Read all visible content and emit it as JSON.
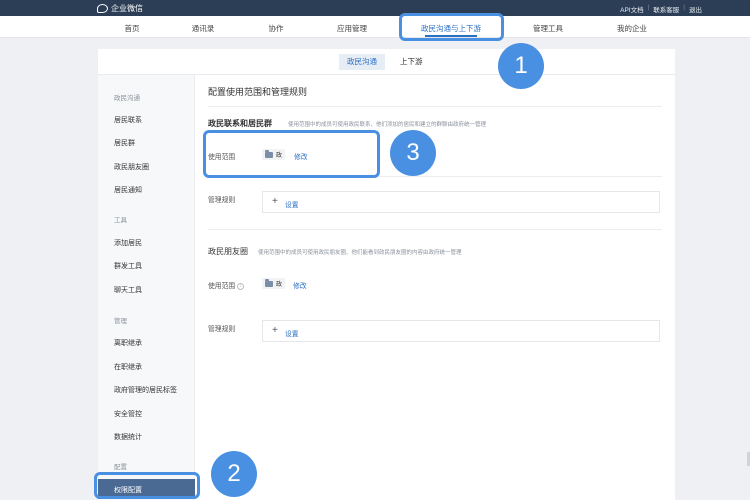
{
  "topbar": {
    "logo_text": "企业微信",
    "links": [
      "API文档",
      "联系客服",
      "退出"
    ]
  },
  "nav": {
    "items": [
      "首页",
      "通讯录",
      "协作",
      "应用管理",
      "政民沟通与上下游",
      "管理工具",
      "我的企业"
    ],
    "active_index": 4
  },
  "subtabs": {
    "active": "政民沟通",
    "other": "上下游"
  },
  "sidebar": {
    "group1": "政民沟通",
    "g1_items": [
      "居民联系",
      "居民群",
      "政民朋友圈",
      "居民通知"
    ],
    "group2": "工具",
    "g2_items": [
      "添加居民",
      "群发工具",
      "聊天工具"
    ],
    "group3": "管理",
    "g3_items": [
      "离职继承",
      "在职继承",
      "政府管理的居民标签",
      "安全管控",
      "数据统计"
    ],
    "group4": "配置",
    "active_item": "权限配置"
  },
  "content": {
    "page_title": "配置使用范围和管理规则",
    "section1": {
      "title": "政民联系和居民群",
      "desc": "使用范围中的成员可使用政民联系、他们添加的居民和建立的群聊由政府统一管理",
      "scope_label": "使用范围",
      "scope_chip": "政",
      "edit": "修改",
      "rules_label": "管理规则",
      "rules_button": "设置"
    },
    "section2": {
      "title": "政民朋友圈",
      "desc": "使用范围中的成员可使用政民朋友圈、他们能看到政民朋友圈的内容由政府统一管理",
      "scope_label": "使用范围",
      "info": "i",
      "scope_chip": "政",
      "edit": "修改",
      "rules_label": "管理规则",
      "rules_button": "设置"
    }
  },
  "annotations": {
    "badges": [
      "1",
      "2",
      "3"
    ],
    "color": "#4a90e2"
  }
}
